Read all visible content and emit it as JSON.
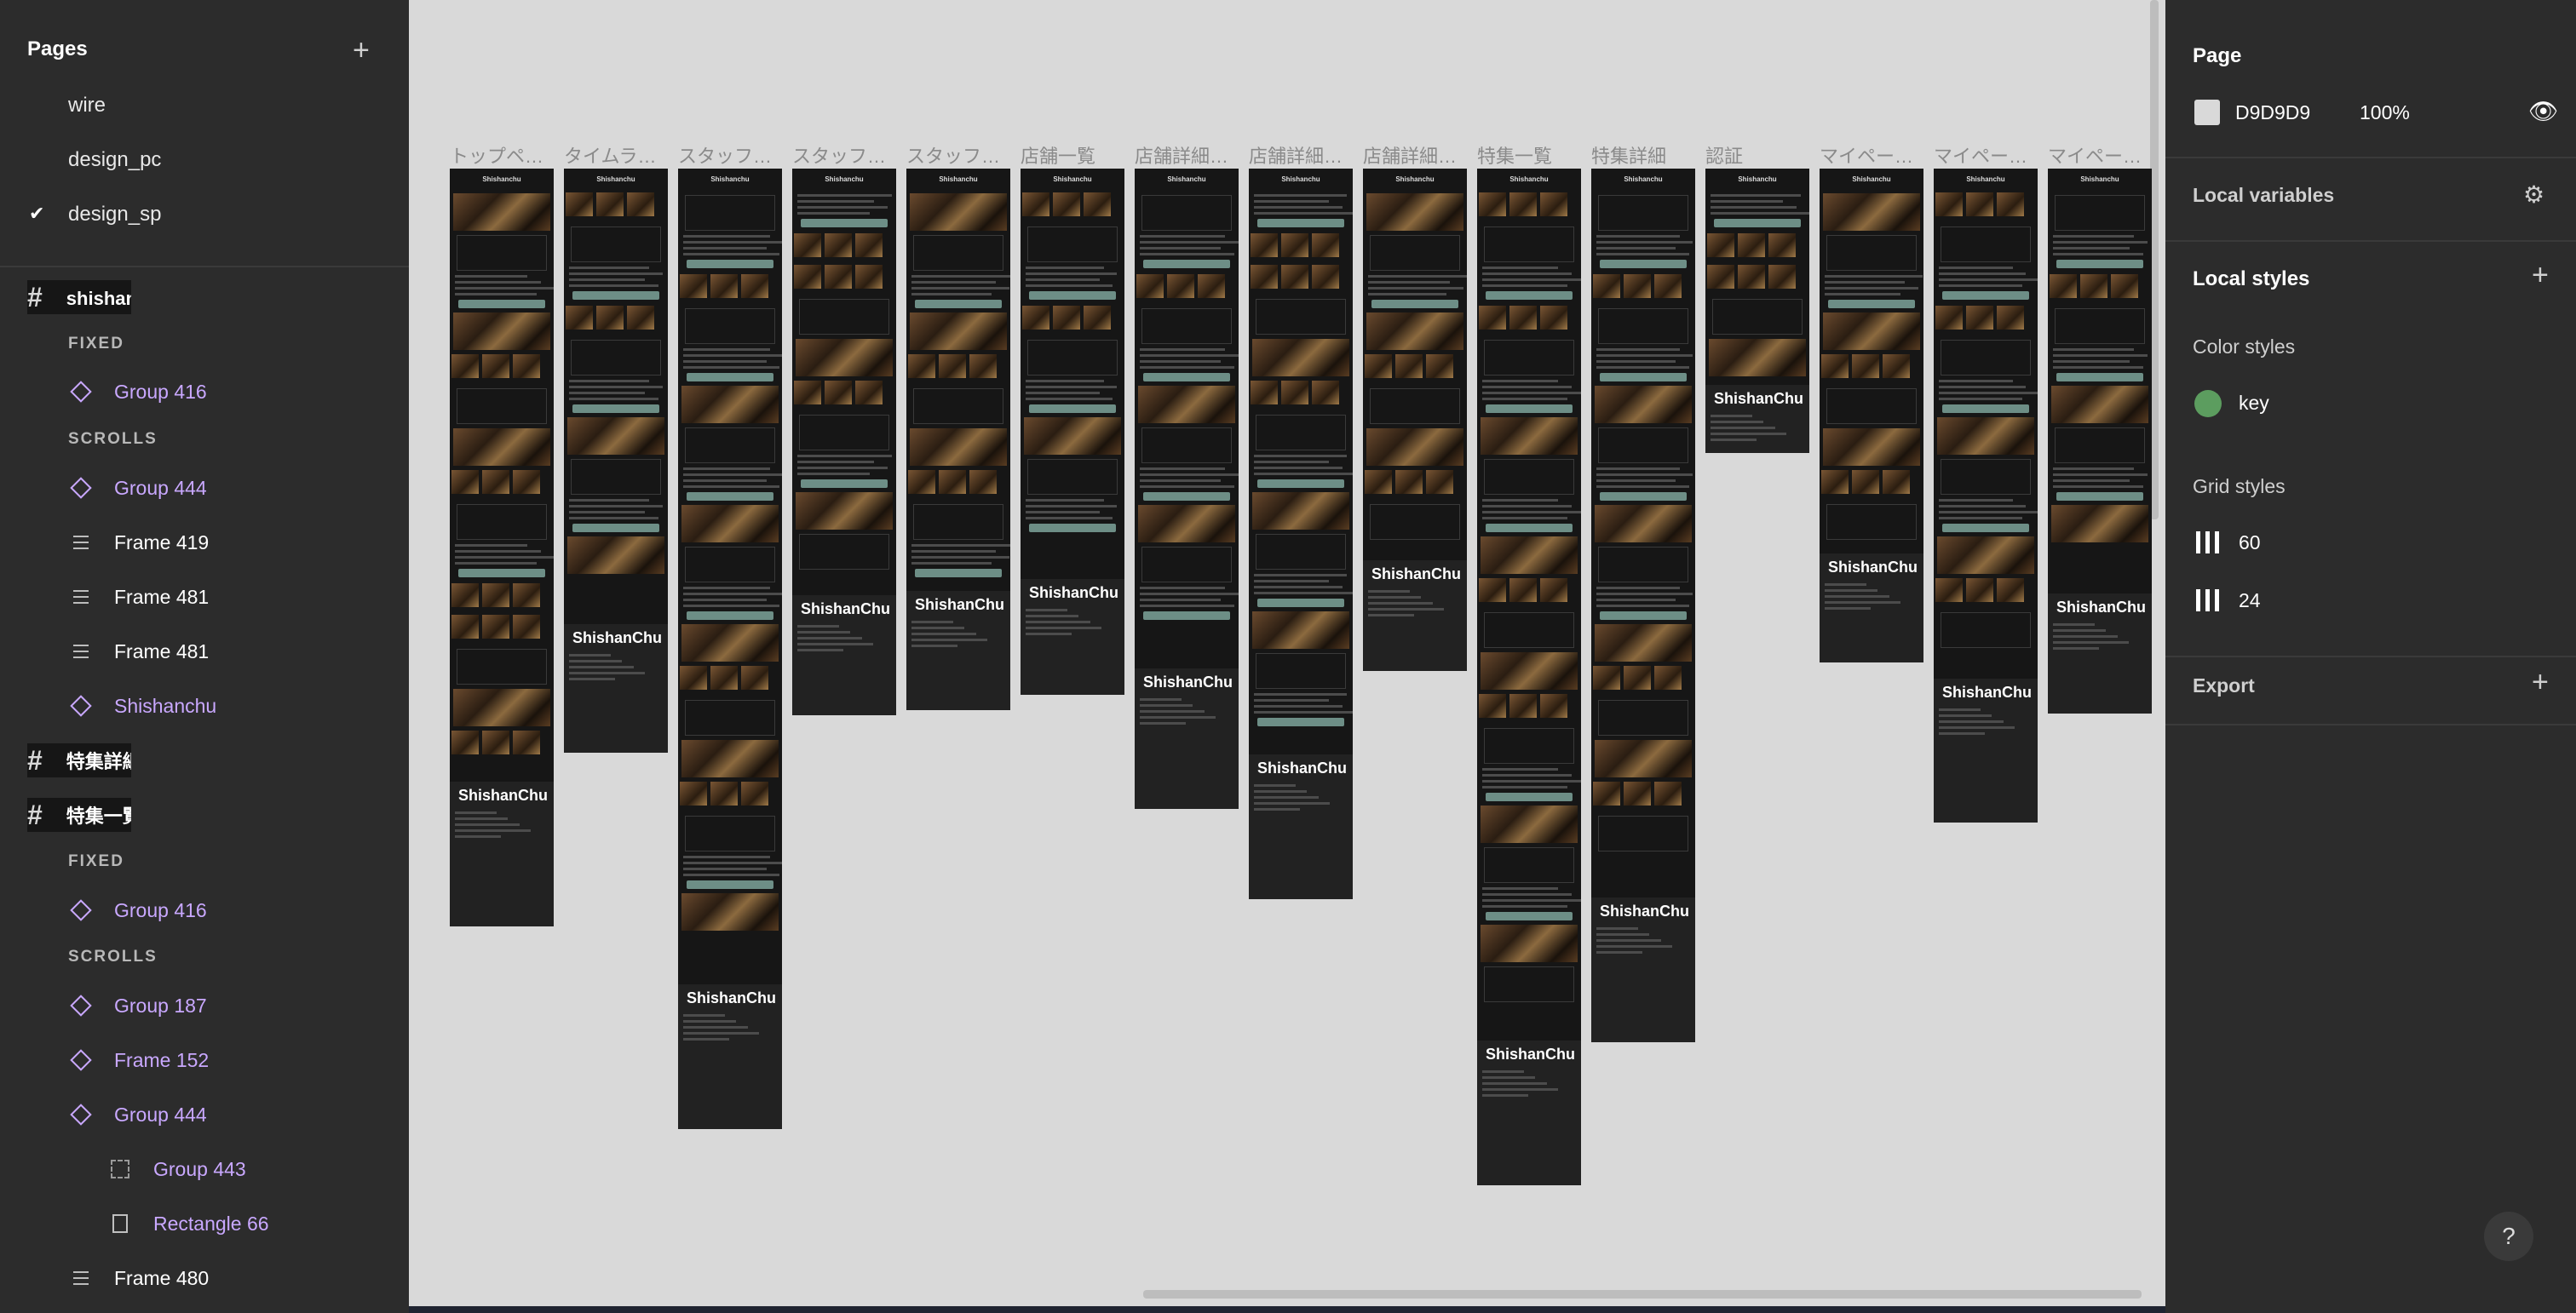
{
  "left_panel": {
    "pages_title": "Pages",
    "pages": [
      {
        "label": "wire",
        "checked": false
      },
      {
        "label": "design_pc",
        "checked": false
      },
      {
        "label": "design_sp",
        "checked": true
      }
    ],
    "layers": [
      {
        "label": "shishanchuについて_シーシャバー…",
        "kind": "frame"
      },
      {
        "label": "FIXED",
        "kind": "section"
      },
      {
        "label": "Group 416",
        "kind": "component"
      },
      {
        "label": "SCROLLS",
        "kind": "section"
      },
      {
        "label": "Group 444",
        "kind": "component"
      },
      {
        "label": "Frame 419",
        "kind": "autolayout"
      },
      {
        "label": "Frame 481",
        "kind": "autolayout"
      },
      {
        "label": "Frame 481",
        "kind": "autolayout"
      },
      {
        "label": "Shishanchu",
        "kind": "component"
      },
      {
        "label": "特集詳細",
        "kind": "frame"
      },
      {
        "label": "特集一覧",
        "kind": "frame"
      },
      {
        "label": "FIXED",
        "kind": "section"
      },
      {
        "label": "Group 416",
        "kind": "component"
      },
      {
        "label": "SCROLLS",
        "kind": "section"
      },
      {
        "label": "Group 187",
        "kind": "component"
      },
      {
        "label": "Frame 152",
        "kind": "component"
      },
      {
        "label": "Group 444",
        "kind": "component"
      },
      {
        "label": "Group 443",
        "kind": "group"
      },
      {
        "label": "Rectangle 66",
        "kind": "rectangle"
      },
      {
        "label": "Frame 480",
        "kind": "autolayout"
      }
    ]
  },
  "right_panel": {
    "page_title": "Page",
    "bg_color_hex": "D9D9D9",
    "bg_opacity": "100%",
    "local_variables": "Local variables",
    "local_styles": "Local styles",
    "color_styles_title": "Color styles",
    "color_styles": [
      {
        "name": "key",
        "color": "#5c9d5f"
      }
    ],
    "grid_styles_title": "Grid styles",
    "grid_styles": [
      {
        "name": "60"
      },
      {
        "name": "24"
      }
    ],
    "export": "Export",
    "help": "?"
  },
  "canvas": {
    "bg_color": "#d9d9d9",
    "frames": [
      {
        "title": "トップペ…",
        "brand": "ShishanChu"
      },
      {
        "title": "タイムラ…",
        "brand": "ShishanChu"
      },
      {
        "title": "スタッフ…",
        "brand": "ShishanChu"
      },
      {
        "title": "スタッフ…",
        "brand": "ShishanChu"
      },
      {
        "title": "スタッフ…",
        "brand": "ShishanChu"
      },
      {
        "title": "店舗一覧",
        "brand": "ShishanChu"
      },
      {
        "title": "店舗詳細…",
        "brand": "ShishanChu"
      },
      {
        "title": "店舗詳細…",
        "brand": "ShishanChu"
      },
      {
        "title": "店舗詳細…",
        "brand": "ShishanChu"
      },
      {
        "title": "特集一覧",
        "brand": "ShishanChu"
      },
      {
        "title": "特集詳細",
        "brand": "ShishanChu"
      },
      {
        "title": "認証",
        "brand": "ShishanChu"
      },
      {
        "title": "マイペー…",
        "brand": "ShishanChu"
      },
      {
        "title": "マイペー…",
        "brand": "ShishanChu"
      },
      {
        "title": "マイペー…",
        "brand": "ShishanChu"
      }
    ],
    "frame_header": "Shishanchu"
  }
}
